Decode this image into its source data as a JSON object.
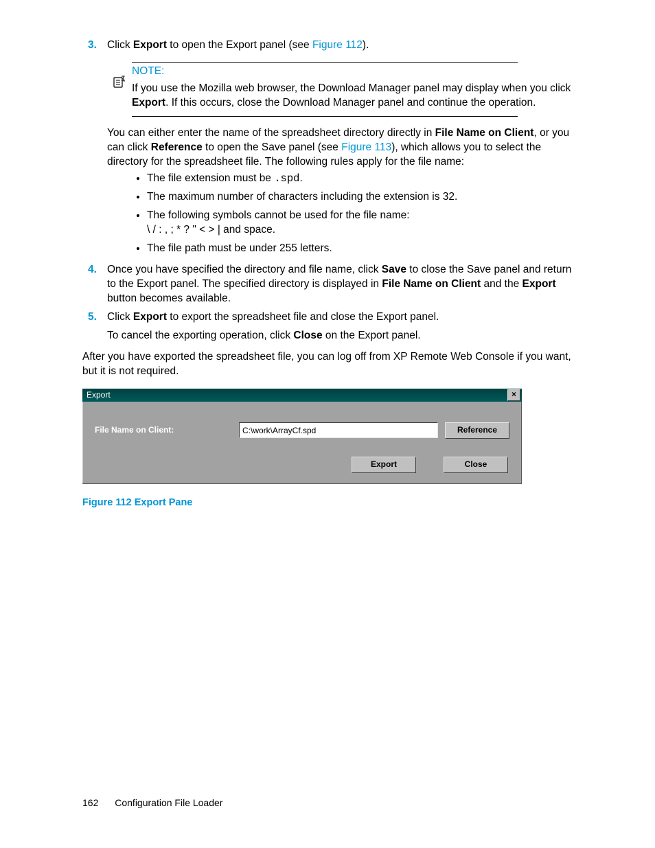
{
  "steps": {
    "s3": {
      "num": "3.",
      "before": "Click ",
      "bold1": "Export",
      "mid": " to open the Export panel (see ",
      "link": "Figure 112",
      "after": ")."
    },
    "note": {
      "title": "NOTE:",
      "line1_pre": "If you use the Mozilla web browser, the Download Manager panel may display when you click ",
      "line1_bold": "Export",
      "line1_post": ". If this occurs, close the Download Manager panel and continue the operation."
    },
    "para1": {
      "pre": "You can either enter the name of the spreadsheet directory directly in ",
      "b1": "File Name on Client",
      "mid1": ", or you can click ",
      "b2": "Reference",
      "mid2": " to open the Save panel (see ",
      "link": "Figure 113",
      "post": "), which allows you to select the directory for the spreadsheet file. The following rules apply for the file name:"
    },
    "rules": {
      "r1_pre": "The file extension must be ",
      "r1_code": ".spd",
      "r1_post": ".",
      "r2": "The maximum number of characters including the extension is 32.",
      "r3": "The following symbols cannot be used for the file name:",
      "r3_syms": "\\ / : , ; * ? \" < > | and space.",
      "r4": "The file path must be under 255 letters."
    },
    "s4": {
      "num": "4.",
      "pre": "Once you have specified the directory and file name, click ",
      "b1": "Save",
      "mid1": " to close the Save panel and return to the Export panel. The specified directory is displayed in ",
      "b2": "File Name on Client",
      "mid2": " and the ",
      "b3": "Export",
      "post": " button becomes available."
    },
    "s5": {
      "num": "5.",
      "pre": "Click ",
      "b1": "Export",
      "post": " to export the spreadsheet file and close the Export panel."
    },
    "s5_extra": {
      "pre": "To cancel the exporting operation, click ",
      "b1": "Close",
      "post": " on the Export panel."
    }
  },
  "body2": "After you have exported the spreadsheet file, you can log off from XP Remote Web Console if you want, but it is not required.",
  "dialog": {
    "title": "Export",
    "label": "File Name on Client:",
    "value": "C:\\work\\ArrayCf.spd",
    "ref_btn": "Reference",
    "export_btn": "Export",
    "close_btn": "Close"
  },
  "caption": "Figure 112 Export Pane",
  "footer": {
    "page": "162",
    "section": "Configuration File Loader"
  }
}
